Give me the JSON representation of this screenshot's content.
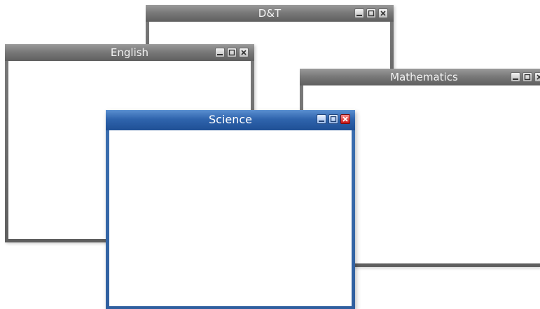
{
  "windows": {
    "dt": {
      "title": "D&T"
    },
    "english": {
      "title": "English"
    },
    "mathematics": {
      "title": "Mathematics"
    },
    "science": {
      "title": "Science"
    }
  },
  "colors": {
    "inactive_frame": "#6f6f6f",
    "active_frame": "#2f5f9f",
    "close_button_active": "#c81414"
  },
  "icons": {
    "minimize": "minimize-icon",
    "maximize": "maximize-icon",
    "close": "close-icon"
  }
}
